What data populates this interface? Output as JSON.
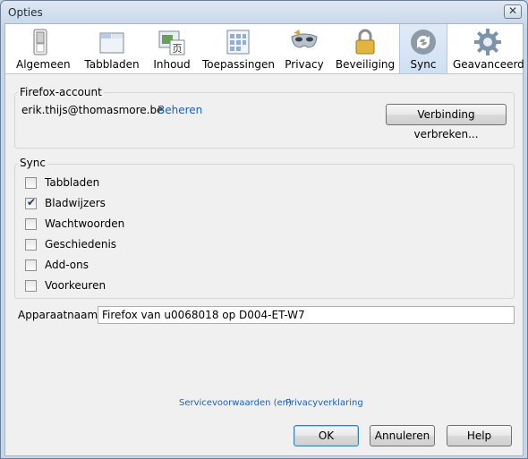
{
  "window": {
    "title": "Opties",
    "close_glyph": "✕"
  },
  "toolbar": {
    "panes": [
      {
        "label": "Algemeen",
        "icon": "switch-icon"
      },
      {
        "label": "Tabbladen",
        "icon": "tabs-icon"
      },
      {
        "label": "Inhoud",
        "icon": "content-icon"
      },
      {
        "label": "Toepassingen",
        "icon": "applications-icon"
      },
      {
        "label": "Privacy",
        "icon": "mask-icon"
      },
      {
        "label": "Beveiliging",
        "icon": "lock-icon"
      },
      {
        "label": "Sync",
        "icon": "sync-icon"
      },
      {
        "label": "Geavanceerd",
        "icon": "gear-icon"
      }
    ],
    "selected": "Sync"
  },
  "account": {
    "group_title": "Firefox-account",
    "email": "erik.thijs@thomasmore.be",
    "manage_link": "Beheren",
    "disconnect_button": "Verbinding verbreken..."
  },
  "sync": {
    "group_title": "Sync",
    "items": [
      {
        "label": "Tabbladen",
        "checked": false
      },
      {
        "label": "Bladwijzers",
        "checked": true
      },
      {
        "label": "Wachtwoorden",
        "checked": false
      },
      {
        "label": "Geschiedenis",
        "checked": false
      },
      {
        "label": "Add-ons",
        "checked": false
      },
      {
        "label": "Voorkeuren",
        "checked": false
      }
    ]
  },
  "device": {
    "label": "Apparaatnaam:",
    "value": "Firefox van u0068018 op D004-ET-W7"
  },
  "footer_links": {
    "terms": "Servicevoorwaarden (en)",
    "privacy": "Privacyverklaring"
  },
  "buttons": {
    "ok": "OK",
    "cancel": "Annuleren",
    "help": "Help"
  },
  "colors": {
    "link": "#1f5fb3",
    "selected_pane": "#cfe0f4",
    "dialog_bg": "#f0f0f0"
  }
}
